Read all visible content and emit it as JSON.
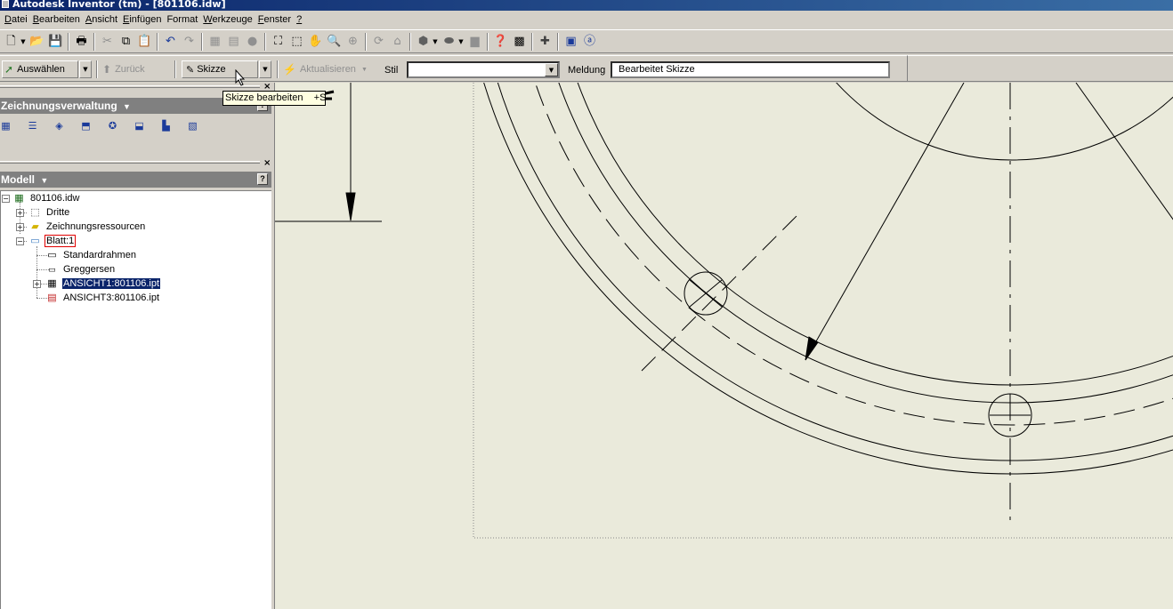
{
  "window": {
    "title": "Autodesk Inventor (tm) - [801106.idw]"
  },
  "menu": [
    {
      "label": "Datei",
      "accel": "D",
      "rest": "atei"
    },
    {
      "label": "Bearbeiten",
      "accel": "B",
      "rest": "earbeiten"
    },
    {
      "label": "Ansicht",
      "accel": "A",
      "rest": "nsicht"
    },
    {
      "label": "Einfügen",
      "accel": "E",
      "rest": "infügen"
    },
    {
      "label": "Format",
      "accel": "",
      "rest": "Format"
    },
    {
      "label": "Werkzeuge",
      "accel": "W",
      "rest": "erkzeuge"
    },
    {
      "label": "Fenster",
      "accel": "F",
      "rest": "enster"
    },
    {
      "label": "?",
      "accel": "?",
      "rest": ""
    }
  ],
  "command_bar": {
    "select_label": "Auswählen",
    "back_label": "Zurück",
    "sketch_label": "Skizze",
    "update_label": "Aktualisieren",
    "style_label": "Stil",
    "style_value": "",
    "message_label": "Meldung",
    "message_value": "Bearbeitet Skizze"
  },
  "tooltip": {
    "text": "Skizze bearbeiten    +S"
  },
  "drawing_panel": {
    "title": "Zeichnungsverwaltung"
  },
  "model_panel": {
    "title": "Modell",
    "tree": [
      {
        "label": "801106.idw",
        "level": 0,
        "icon": "drawing-icon"
      },
      {
        "label": "Dritte",
        "level": 1,
        "icon": "folder-icon"
      },
      {
        "label": "Zeichnungsressourcen",
        "level": 1,
        "icon": "folder-icon"
      },
      {
        "label": "Blatt:1",
        "level": 1,
        "icon": "sheet-icon"
      },
      {
        "label": "Standardrahmen",
        "level": 2,
        "icon": "border-icon"
      },
      {
        "label": "Greggersen",
        "level": 2,
        "icon": "title-block-icon"
      },
      {
        "label": "ANSICHT1:801106.ipt",
        "level": 2,
        "icon": "view-icon"
      },
      {
        "label": "ANSICHT3:801106.ipt",
        "level": 2,
        "icon": "section-view-icon"
      }
    ]
  }
}
